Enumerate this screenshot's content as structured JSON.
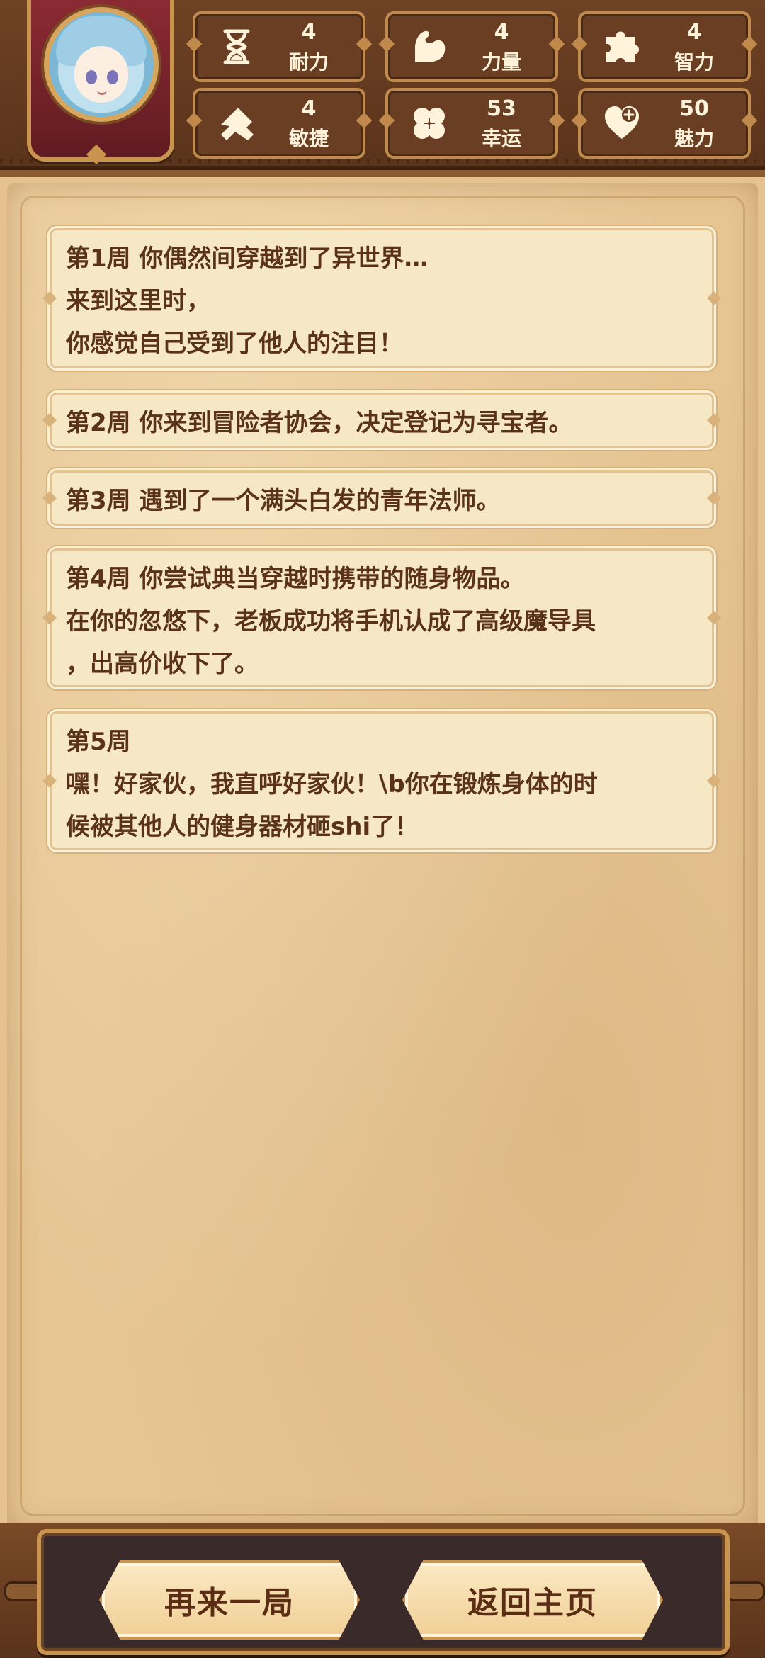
{
  "stats": [
    {
      "icon": "hourglass-icon",
      "value": "4",
      "label": "耐力"
    },
    {
      "icon": "strength-arm-icon",
      "value": "4",
      "label": "力量"
    },
    {
      "icon": "puzzle-icon",
      "value": "4",
      "label": "智力"
    },
    {
      "icon": "feather-icon",
      "value": "4",
      "label": "敏捷"
    },
    {
      "icon": "clover-icon",
      "value": "53",
      "label": "幸运"
    },
    {
      "icon": "heart-plus-icon",
      "value": "50",
      "label": "魅力"
    }
  ],
  "events": [
    {
      "lines": [
        "第1周 你偶然间穿越到了异世界…",
        "来到这里时，",
        "你感觉自己受到了他人的注目！"
      ]
    },
    {
      "lines": [
        "第2周 你来到冒险者协会，决定登记为寻宝者。"
      ]
    },
    {
      "lines": [
        "第3周 遇到了一个满头白发的青年法师。"
      ]
    },
    {
      "lines": [
        "第4周 你尝试典当穿越时携带的随身物品。",
        "在你的忽悠下，老板成功将手机认成了高级魔导具",
        "，出高价收下了。"
      ]
    },
    {
      "lines": [
        "第5周",
        "嘿！好家伙，我直呼好家伙！\\b你在锻炼身体的时",
        "候被其他人的健身器材砸shi了！"
      ]
    }
  ],
  "buttons": {
    "replay": "再来一局",
    "home": "返回主页"
  },
  "colors": {
    "text": "#5a3218",
    "card_bg": "#f6e7c5",
    "stat_bg": "#6a3e22",
    "accent": "#c9944e"
  }
}
